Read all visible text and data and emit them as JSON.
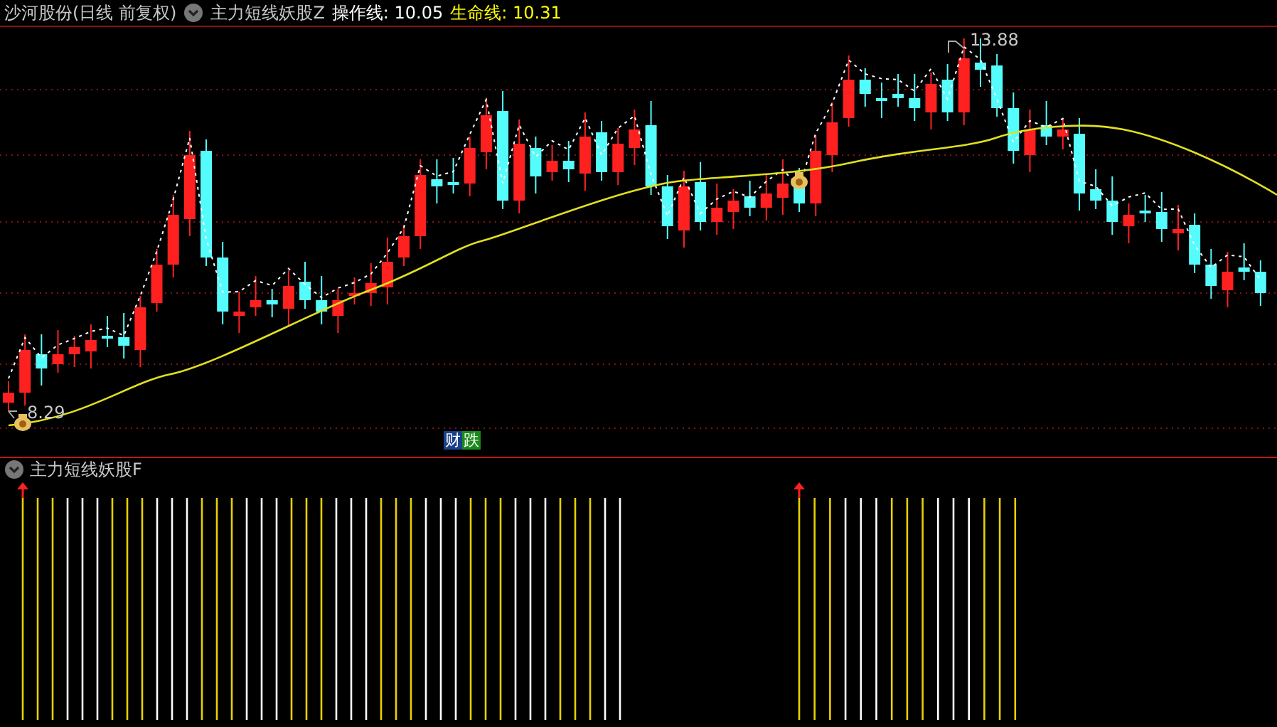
{
  "header": {
    "title": "沙河股份(日线 前复权)",
    "indicator": "主力短线妖股Z",
    "lines": [
      {
        "text": "操作线: 10.05",
        "color": "#ffffff"
      },
      {
        "text": "生命线: 10.31",
        "color": "#ffff00"
      }
    ]
  },
  "main_chart": {
    "high_label": "13.88",
    "low_label": "8.29",
    "badges": [
      {
        "text": "财",
        "color": "#1c3f8c"
      },
      {
        "text": "跌",
        "color": "#1a8a1a"
      }
    ]
  },
  "sub_panel": {
    "title": "主力短线妖股F"
  }
}
